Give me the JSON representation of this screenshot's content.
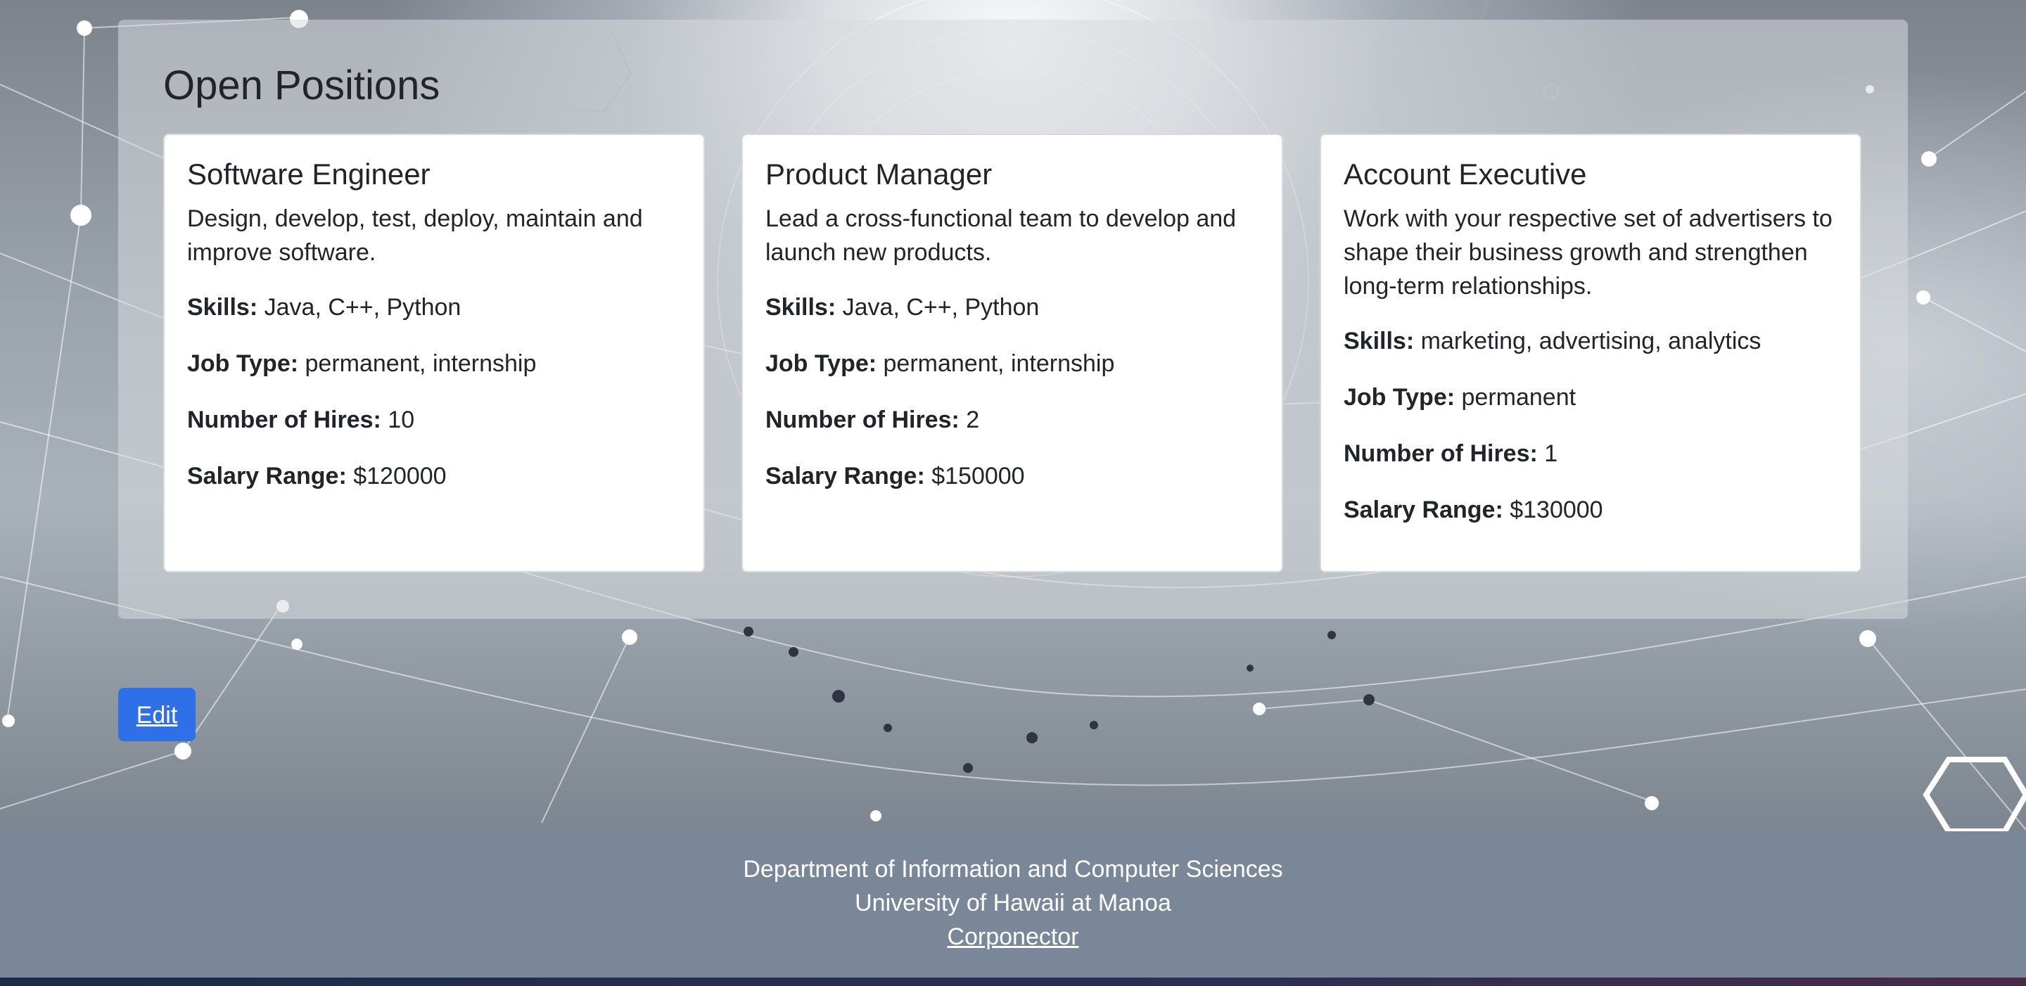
{
  "page": {
    "heading": "Open Positions"
  },
  "jobs": [
    {
      "title": "Software Engineer",
      "description": "Design, develop, test, deploy, maintain and improve software.",
      "skills_label": "Skills:",
      "skills": "Java, C++, Python",
      "job_type_label": "Job Type:",
      "job_type": "permanent, internship",
      "hires_label": "Number of Hires:",
      "hires": "10",
      "salary_label": "Salary Range:",
      "salary": "$120000"
    },
    {
      "title": "Product Manager",
      "description": "Lead a cross-functional team to develop and launch new products.",
      "skills_label": "Skills:",
      "skills": "Java, C++, Python",
      "job_type_label": "Job Type:",
      "job_type": "permanent, internship",
      "hires_label": "Number of Hires:",
      "hires": "2",
      "salary_label": "Salary Range:",
      "salary": "$150000"
    },
    {
      "title": "Account Executive",
      "description": "Work with your respective set of advertisers to shape their business growth and strengthen long-term relationships.",
      "skills_label": "Skills:",
      "skills": "marketing, advertising, analytics",
      "job_type_label": "Job Type:",
      "job_type": "permanent",
      "hires_label": "Number of Hires:",
      "hires": "1",
      "salary_label": "Salary Range:",
      "salary": "$130000"
    }
  ],
  "actions": {
    "edit_label": "Edit"
  },
  "footer": {
    "line1": "Department of Information and Computer Sciences",
    "line2": "University of Hawaii at Manoa",
    "link": "Corponector"
  },
  "colors": {
    "edit_button": "#2f6fe8",
    "footer_bg": "#7a8799"
  }
}
